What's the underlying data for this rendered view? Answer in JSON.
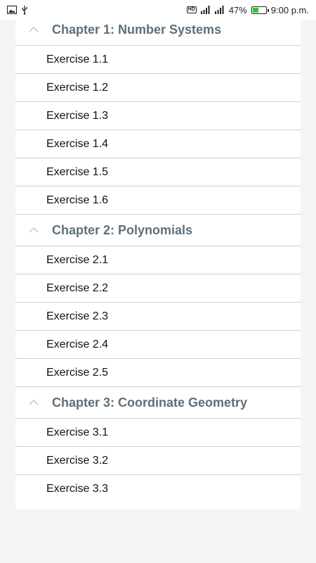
{
  "status_bar": {
    "battery_percent": "47%",
    "battery_level": 0.47,
    "time": "9:00 p.m.",
    "hd_badge": "HD",
    "icons": [
      "image-icon",
      "usb-icon",
      "hd-voice-icon",
      "signal-icon",
      "signal-icon",
      "battery-icon"
    ]
  },
  "chapters": [
    {
      "title": "Chapter 1: Number Systems",
      "exercises": [
        "Exercise 1.1",
        "Exercise 1.2",
        "Exercise 1.3",
        "Exercise 1.4",
        "Exercise 1.5",
        "Exercise 1.6"
      ]
    },
    {
      "title": "Chapter 2: Polynomials",
      "exercises": [
        "Exercise 2.1",
        "Exercise 2.2",
        "Exercise 2.3",
        "Exercise 2.4",
        "Exercise 2.5"
      ]
    },
    {
      "title": "Chapter 3: Coordinate Geometry",
      "exercises": [
        "Exercise 3.1",
        "Exercise 3.2",
        "Exercise 3.3"
      ]
    }
  ],
  "colors": {
    "chapter_title": "#5f6f7a",
    "battery_fill": "#22cc33",
    "divider": "#d0d0d0"
  }
}
